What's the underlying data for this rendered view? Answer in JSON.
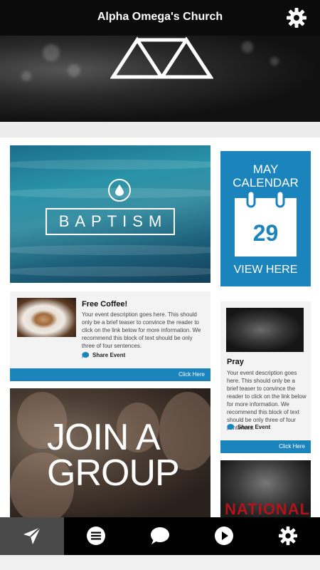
{
  "header": {
    "title": "Alpha Omega's Church",
    "settings_icon": "gear-icon"
  },
  "featured": {
    "baptism_label": "BAPTISM"
  },
  "calendar": {
    "month": "MAY",
    "label": "CALENDAR",
    "day": "29",
    "cta": "VIEW HERE"
  },
  "events": [
    {
      "title": "Free Coffee!",
      "description": "Your event description goes here. This should only be a brief teaser to convince the reader to click on the link below for more information. We recommend this block of text should be only three of four sentences.",
      "share": "Share Event",
      "click": "Click Here"
    },
    {
      "title": "Pray",
      "description": "Your event description goes here. This should only be a brief teaser to convince the reader to click on the link below for more information. We recommend this block of text should be only three of four sentences.",
      "share": "Share Event",
      "click": "Click Here"
    }
  ],
  "group": {
    "line1": "JOIN A",
    "line2": "GROUP"
  },
  "national": {
    "text": "NATIONAL"
  },
  "tabs": [
    {
      "icon": "paper-plane-icon",
      "active": true
    },
    {
      "icon": "menu-list-icon",
      "active": false
    },
    {
      "icon": "chat-bubble-icon",
      "active": false
    },
    {
      "icon": "play-icon",
      "active": false
    },
    {
      "icon": "gear-icon",
      "active": false
    }
  ],
  "colors": {
    "accent": "#1b84bd",
    "bar": "#0b0b0b"
  }
}
